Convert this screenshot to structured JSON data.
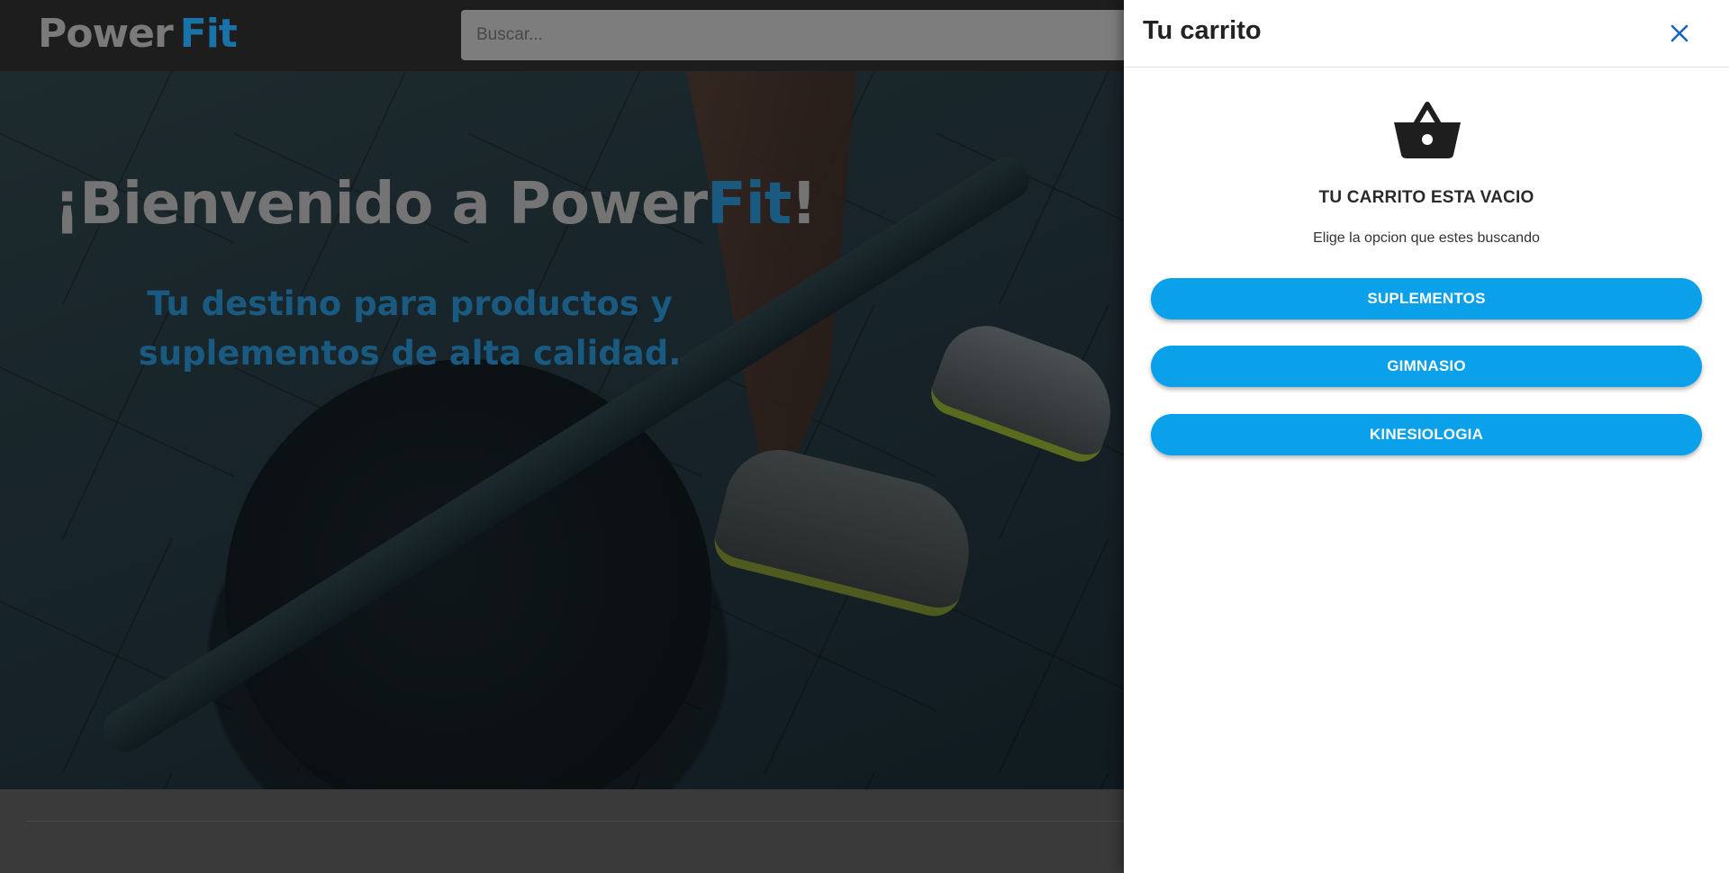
{
  "header": {
    "logo_power": "Power",
    "logo_fit": "Fit",
    "search_placeholder": "Buscar..."
  },
  "hero": {
    "title_prefix": "¡Bienvenido a Power",
    "title_fit": "Fit",
    "title_suffix": "!",
    "subtitle": "Tu destino para productos y suplementos de alta calidad."
  },
  "cart": {
    "title": "Tu carrito",
    "close_icon": "close-icon",
    "empty_icon": "basket-icon",
    "empty_title": "TU CARRITO ESTA VACIO",
    "empty_subtitle": "Elige la opcion que estes buscando",
    "buttons": [
      "SUPLEMENTOS",
      "GIMNASIO",
      "KINESIOLOGIA"
    ]
  },
  "colors": {
    "accent": "#0aa0ea",
    "brand_blue": "#1a73a8",
    "close_icon": "#1565c0",
    "navbar": "#1d1d1d"
  }
}
